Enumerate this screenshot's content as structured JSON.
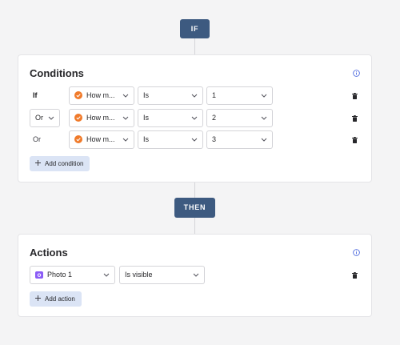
{
  "flow": {
    "if_label": "IF",
    "then_label": "THEN"
  },
  "conditions": {
    "title": "Conditions",
    "rows": [
      {
        "connector": "If",
        "field": "How m...",
        "operator": "Is",
        "value": "1"
      },
      {
        "connector": "Or",
        "field": "How m...",
        "operator": "Is",
        "value": "2"
      },
      {
        "connector": "Or",
        "field": "How m...",
        "operator": "Is",
        "value": "3"
      }
    ],
    "add_label": "Add condition"
  },
  "actions": {
    "title": "Actions",
    "rows": [
      {
        "target": "Photo 1",
        "action": "Is visible"
      }
    ],
    "add_label": "Add action"
  },
  "icons": {
    "field_icon": "orange-check-circle-icon",
    "target_icon": "purple-camera-icon",
    "info": "info-circle-icon",
    "delete": "trash-icon",
    "dropdown": "chevron-down-icon",
    "add": "plus-icon"
  },
  "colors": {
    "pill": "#3d5a80",
    "add_button_bg": "#dbe4f5",
    "field_icon": "#f07a2a",
    "target_icon": "#8b5cf6",
    "info_icon": "#3b5bdb"
  }
}
